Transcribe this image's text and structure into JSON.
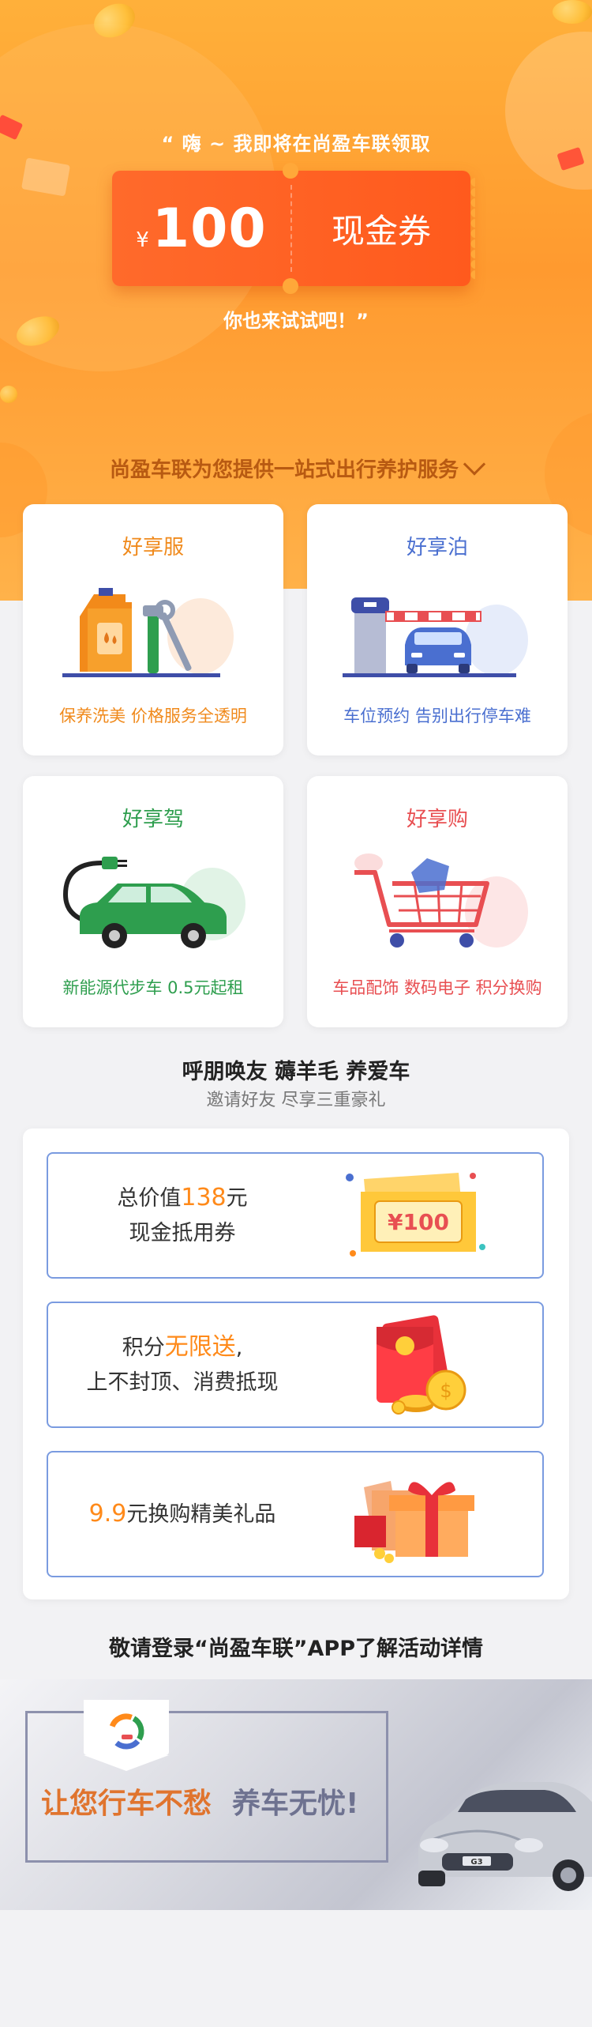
{
  "hero": {
    "line1": "“ 嗨 ~ 我即将在尚盈车联领取",
    "coupon": {
      "currency": "¥",
      "amount": "100",
      "label": "现金券"
    },
    "line2": "你也来试试吧！”"
  },
  "services": {
    "title": "尚盈车联为您提供一站式出行养护服务",
    "cards": [
      {
        "title": "好享服",
        "desc": "保养洗美 价格服务全透明",
        "color": "#f08a1c"
      },
      {
        "title": "好享泊",
        "desc": "车位预约 告别出行停车难",
        "color": "#4a6fd0"
      },
      {
        "title": "好享驾",
        "desc": "新能源代步车 0.5元起租",
        "color": "#2e9e4e"
      },
      {
        "title": "好享购",
        "desc": "车品配饰 数码电子 积分换购",
        "color": "#e84f52"
      }
    ]
  },
  "invite": {
    "title": "呼朋唤友 薅羊毛 养爱车",
    "subtitle": "邀请好友 尽享三重豪礼",
    "benefits": [
      {
        "pre": "总价值",
        "highlight": "138",
        "post": "元",
        "line2": "现金抵用券",
        "ticket_text": "¥100"
      },
      {
        "pre": "积分",
        "highlight": "无限送",
        "post": ",",
        "line2": "上不封顶、消费抵现"
      },
      {
        "pre": "",
        "highlight": "9.9",
        "post": "元换购精美礼品",
        "line2": ""
      }
    ]
  },
  "login_note": "敬请登录“尚盈车联”APP了解活动详情",
  "banner": {
    "slogan_part1": "让您行车不愁",
    "slogan_part2": "养车无忧!",
    "car_plate": "G3"
  }
}
